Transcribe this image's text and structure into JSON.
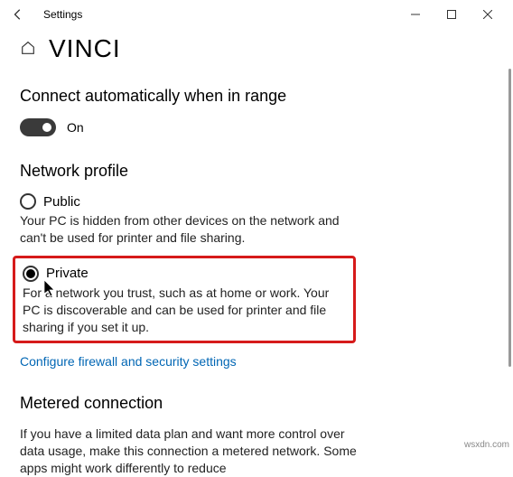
{
  "titlebar": {
    "title": "Settings"
  },
  "header": {
    "page_title": "VINCI"
  },
  "auto_connect": {
    "heading": "Connect automatically when in range",
    "toggle_label": "On"
  },
  "profile": {
    "heading": "Network profile",
    "public": {
      "label": "Public",
      "desc": "Your PC is hidden from other devices on the network and can't be used for printer and file sharing."
    },
    "private": {
      "label": "Private",
      "desc": "For a network you trust, such as at home or work. Your PC is discoverable and can be used for printer and file sharing if you set it up."
    },
    "firewall_link": "Configure firewall and security settings"
  },
  "metered": {
    "heading": "Metered connection",
    "desc": "If you have a limited data plan and want more control over data usage, make this connection a metered network. Some apps might work differently to reduce"
  },
  "watermark": "wsxdn.com"
}
